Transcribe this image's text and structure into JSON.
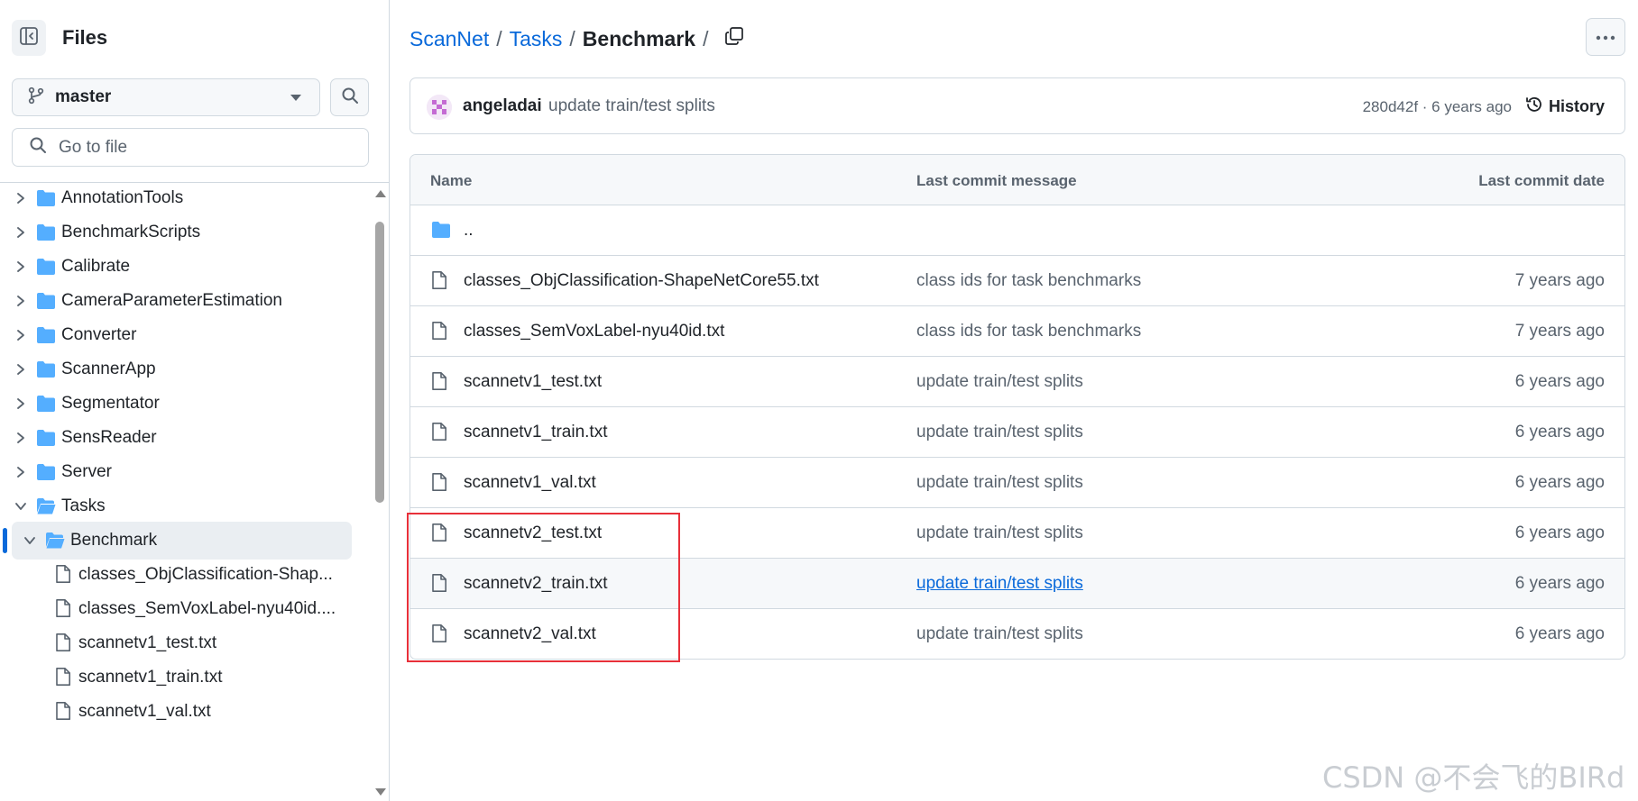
{
  "sidebar": {
    "title": "Files",
    "branch": "master",
    "go_to_file_placeholder": "Go to file",
    "tree": [
      {
        "label": "AnnotationTools",
        "type": "folder",
        "expanded": false
      },
      {
        "label": "BenchmarkScripts",
        "type": "folder",
        "expanded": false
      },
      {
        "label": "Calibrate",
        "type": "folder",
        "expanded": false
      },
      {
        "label": "CameraParameterEstimation",
        "type": "folder",
        "expanded": false
      },
      {
        "label": "Converter",
        "type": "folder",
        "expanded": false
      },
      {
        "label": "ScannerApp",
        "type": "folder",
        "expanded": false
      },
      {
        "label": "Segmentator",
        "type": "folder",
        "expanded": false
      },
      {
        "label": "SensReader",
        "type": "folder",
        "expanded": false
      },
      {
        "label": "Server",
        "type": "folder",
        "expanded": false
      },
      {
        "label": "Tasks",
        "type": "folder",
        "expanded": true
      },
      {
        "label": "Benchmark",
        "type": "folder-open",
        "expanded": true,
        "selected": true
      },
      {
        "label": "classes_ObjClassification-Shap...",
        "type": "file"
      },
      {
        "label": "classes_SemVoxLabel-nyu40id....",
        "type": "file"
      },
      {
        "label": "scannetv1_test.txt",
        "type": "file"
      },
      {
        "label": "scannetv1_train.txt",
        "type": "file"
      },
      {
        "label": "scannetv1_val.txt",
        "type": "file"
      }
    ]
  },
  "breadcrumb": {
    "repo": "ScanNet",
    "folder": "Tasks",
    "current": "Benchmark",
    "separator": "/"
  },
  "commit": {
    "author": "angeladai",
    "message": "update train/test splits",
    "meta": "280d42f · 6 years ago",
    "history_label": "History"
  },
  "table": {
    "headers": {
      "name": "Name",
      "message": "Last commit message",
      "date": "Last commit date"
    },
    "parent_label": "..",
    "rows": [
      {
        "name": "classes_ObjClassification-ShapeNetCore55.txt",
        "message": "class ids for task benchmarks",
        "date": "7 years ago"
      },
      {
        "name": "classes_SemVoxLabel-nyu40id.txt",
        "message": "class ids for task benchmarks",
        "date": "7 years ago"
      },
      {
        "name": "scannetv1_test.txt",
        "message": "update train/test splits",
        "date": "6 years ago"
      },
      {
        "name": "scannetv1_train.txt",
        "message": "update train/test splits",
        "date": "6 years ago"
      },
      {
        "name": "scannetv1_val.txt",
        "message": "update train/test splits",
        "date": "6 years ago"
      },
      {
        "name": "scannetv2_test.txt",
        "message": "update train/test splits",
        "date": "6 years ago"
      },
      {
        "name": "scannetv2_train.txt",
        "message": "update train/test splits",
        "date": "6 years ago",
        "hovered": true
      },
      {
        "name": "scannetv2_val.txt",
        "message": "update train/test splits",
        "date": "6 years ago"
      }
    ]
  },
  "watermark": "CSDN @不会飞的BIRd",
  "colors": {
    "link": "#0969da",
    "folder": "#54aeff",
    "border": "#d1d9e0",
    "muted": "#59636e",
    "highlight_box": "#e8303a"
  },
  "icons": [
    "sidebar-collapse-icon",
    "git-branch-icon",
    "search-icon",
    "chevron-right-icon",
    "chevron-down-icon",
    "folder-icon",
    "file-icon",
    "copy-icon",
    "kebab-icon",
    "history-icon"
  ]
}
